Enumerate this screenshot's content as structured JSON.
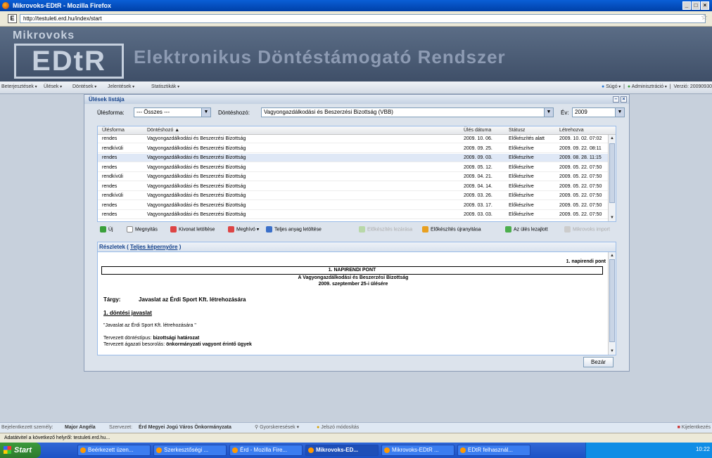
{
  "window": {
    "title": "Mikrovoks-EDtR - Mozilla Firefox",
    "url": "http://testuleti.erd.hu/index/start"
  },
  "header": {
    "brand_small": "Mikrovoks",
    "brand_logo": "EDtR",
    "title": "Elektronikus Döntéstámogató Rendszer"
  },
  "menu": {
    "items": [
      "Beterjesztések",
      "Ülések",
      "Döntések",
      "Jelentések",
      "Statisztikák"
    ],
    "help": "Súgó",
    "admin": "Adminisztráció",
    "version": "Verzió: 20090930"
  },
  "panel": {
    "title": "Ülések listája",
    "filters": {
      "type_label": "Ülésforma:",
      "type_value": "--- Összes ---",
      "decider_label": "Döntéshozó:",
      "decider_value": "Vagyongazdálkodási és Beszerzési Bizottság (VBB)",
      "year_label": "Év:",
      "year_value": "2009"
    },
    "columns": [
      "Ülésforma",
      "Döntéshozó ▲",
      "Ülés dátuma",
      "Státusz",
      "Létrehozva"
    ],
    "rows": [
      [
        "rendes",
        "Vagyongazdálkodási és Beszerzési Bizottság",
        "2009. 10. 06.",
        "Előkészítés alatt",
        "2009. 10. 02. 07:02"
      ],
      [
        "rendkívüli",
        "Vagyongazdálkodási és Beszerzési Bizottság",
        "2009. 09. 25.",
        "Előkészítve",
        "2009. 09. 22. 08:11"
      ],
      [
        "rendes",
        "Vagyongazdálkodási és Beszerzési Bizottság",
        "2009. 09. 03.",
        "Előkészítve",
        "2009. 08. 28. 11:15"
      ],
      [
        "rendes",
        "Vagyongazdálkodási és Beszerzési Bizottság",
        "2009. 05. 12.",
        "Előkészítve",
        "2009. 05. 22. 07:50"
      ],
      [
        "rendkívüli",
        "Vagyongazdálkodási és Beszerzési Bizottság",
        "2009. 04. 21.",
        "Előkészítve",
        "2009. 05. 22. 07:50"
      ],
      [
        "rendes",
        "Vagyongazdálkodási és Beszerzési Bizottság",
        "2009. 04. 14.",
        "Előkészítve",
        "2009. 05. 22. 07:50"
      ],
      [
        "rendkívüli",
        "Vagyongazdálkodási és Beszerzési Bizottság",
        "2009. 03. 26.",
        "Előkészítve",
        "2009. 05. 22. 07:50"
      ],
      [
        "rendes",
        "Vagyongazdálkodási és Beszerzési Bizottság",
        "2009. 03. 17.",
        "Előkészítve",
        "2009. 05. 22. 07:50"
      ],
      [
        "rendes",
        "Vagyongazdálkodási és Beszerzési Bizottság",
        "2009. 03. 03.",
        "Előkészítve",
        "2009. 05. 22. 07:50"
      ]
    ],
    "toolbar": {
      "new": "Új",
      "open": "Megnyitás",
      "excerpt": "Kivonat letöltése",
      "invite": "Meghívó",
      "full": "Teljes anyag letöltése",
      "close_prep": "Előkészítés lezárása",
      "restart_prep": "Előkészítés újranyitása",
      "closed": "Az ülés lezajlott",
      "import": "Mikrovoks import"
    },
    "details": {
      "title_prefix": "Részletek (",
      "fullscreen": "Teljes képernyőre",
      "title_suffix": ")",
      "napi_right": "1. napirendi pont",
      "napi_box": "1. NAPIRENDI PONT",
      "committee": "A Vagyongazdálkodási és Beszerzési Bizottság",
      "meeting": "2009. szeptember 25-i ülésére",
      "subject_label": "Tárgy:",
      "subject": "Javaslat az Érdi Sport Kft. létrehozására",
      "proposal_heading": "1. döntési javaslat",
      "proposal_quote": "\"Javaslat az Érdi Sport Kft. létrehozására \"",
      "type_label": "Tervezett döntéstípus:",
      "type_value": "bizottsági határozat",
      "cat_label": "Tervezett ágazati besorolás:",
      "cat_value": "önkormányzati vagyont érintő ügyek"
    },
    "close_button": "Bezár"
  },
  "status": {
    "user_label": "Bejelentkezett személy:",
    "user": "Major Angéla",
    "org_label": "Szervezet:",
    "org": "Érd Megyei Jogú Város Önkormányzata",
    "quicksearch": "Gyorskeresések",
    "password": "Jelszó módosítás",
    "logout": "Kijelentkezés"
  },
  "browser_status": "Adatátvitel a következő helyről: testuleti.erd.hu...",
  "taskbar": {
    "start": "Start",
    "tasks": [
      "Beérkezett üzen...",
      "Szerkesztőségi ...",
      "Érd - Mozilla Fire...",
      "Mikrovoks-ED...",
      "Mikrovoks-EDtR ...",
      "EDtR felhasznál..."
    ],
    "clock": "10:22"
  }
}
